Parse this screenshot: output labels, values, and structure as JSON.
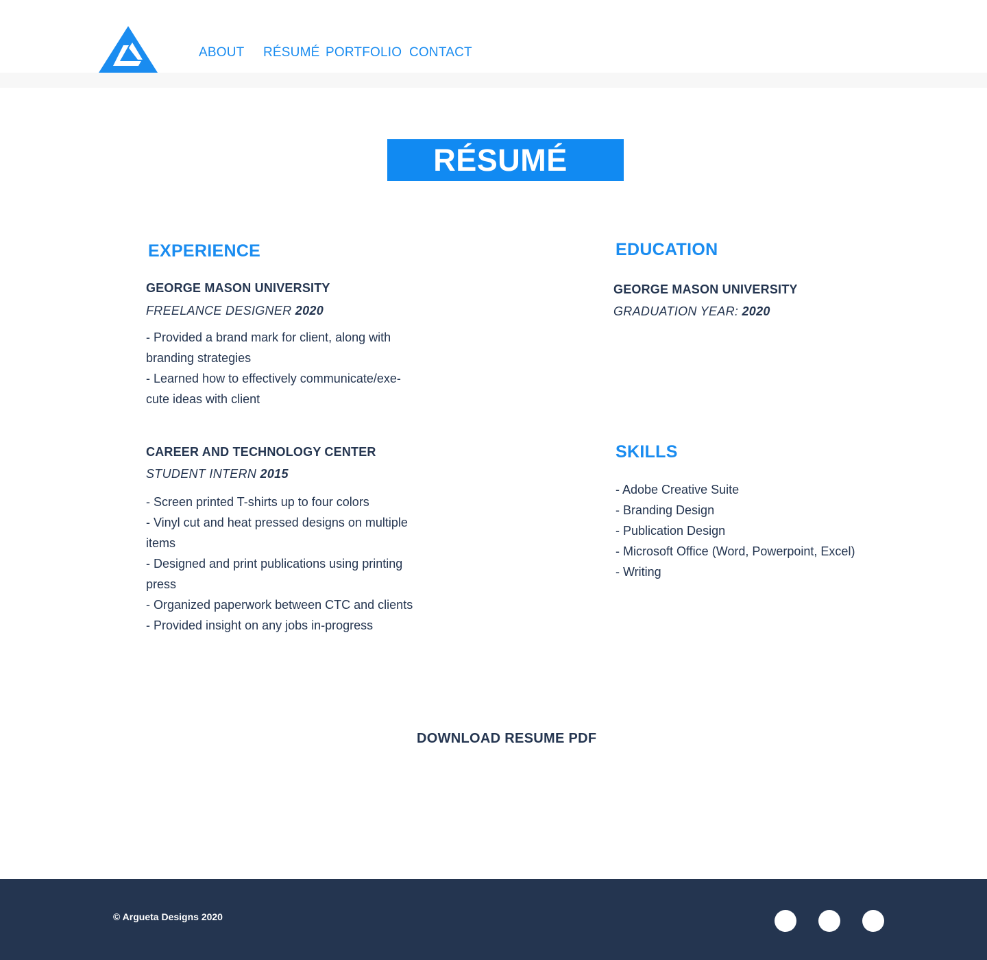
{
  "header": {
    "logo_icon": "triangle-monogram-logo-icon",
    "nav": [
      {
        "label": "ABOUT"
      },
      {
        "label": "RÉSUMÉ"
      },
      {
        "label": "PORTFOLIO"
      },
      {
        "label": "CONTACT"
      }
    ]
  },
  "page_title": "RÉSUMÉ",
  "experience": {
    "heading": "EXPERIENCE",
    "entries": [
      {
        "org": "GEORGE MASON UNIVERSITY",
        "role": "FREELANCE DESIGNER",
        "year": "2020",
        "bullets": [
          " -  Provided a brand mark for client, along with",
          "branding strategies",
          " -  Learned how to effectively communicate/exe-",
          "cute ideas with client"
        ]
      },
      {
        "org": "CAREER AND TECHNOLOGY CENTER",
        "role": "STUDENT INTERN",
        "year": "2015",
        "bullets": [
          " -  Screen printed T-shirts up to four colors",
          " -  Vinyl cut and heat pressed designs on multiple",
          "items",
          " -  Designed and print publications using printing",
          "press",
          " -  Organized paperwork between CTC and clients",
          " -  Provided insight on any jobs in-progress"
        ]
      }
    ]
  },
  "education": {
    "heading": "EDUCATION",
    "org": "GEORGE MASON UNIVERSITY",
    "label": "GRADUATION YEAR:",
    "year": "2020"
  },
  "skills": {
    "heading": "SKILLS",
    "items": [
      "- Adobe Creative Suite",
      "- Branding Design",
      "- Publication Design",
      "- Microsoft Office (Word, Powerpoint, Excel)",
      "- Writing"
    ]
  },
  "download_label": "DOWNLOAD RESUME PDF",
  "footer": {
    "copyright": "© Argueta Designs 2020",
    "social_icons": [
      "social-icon-1",
      "social-icon-2",
      "social-icon-3"
    ]
  },
  "colors": {
    "accent": "#1a8cf0",
    "banner": "#118af2",
    "text": "#243550",
    "footer": "#243550",
    "header_strip": "#f7f7f7"
  }
}
